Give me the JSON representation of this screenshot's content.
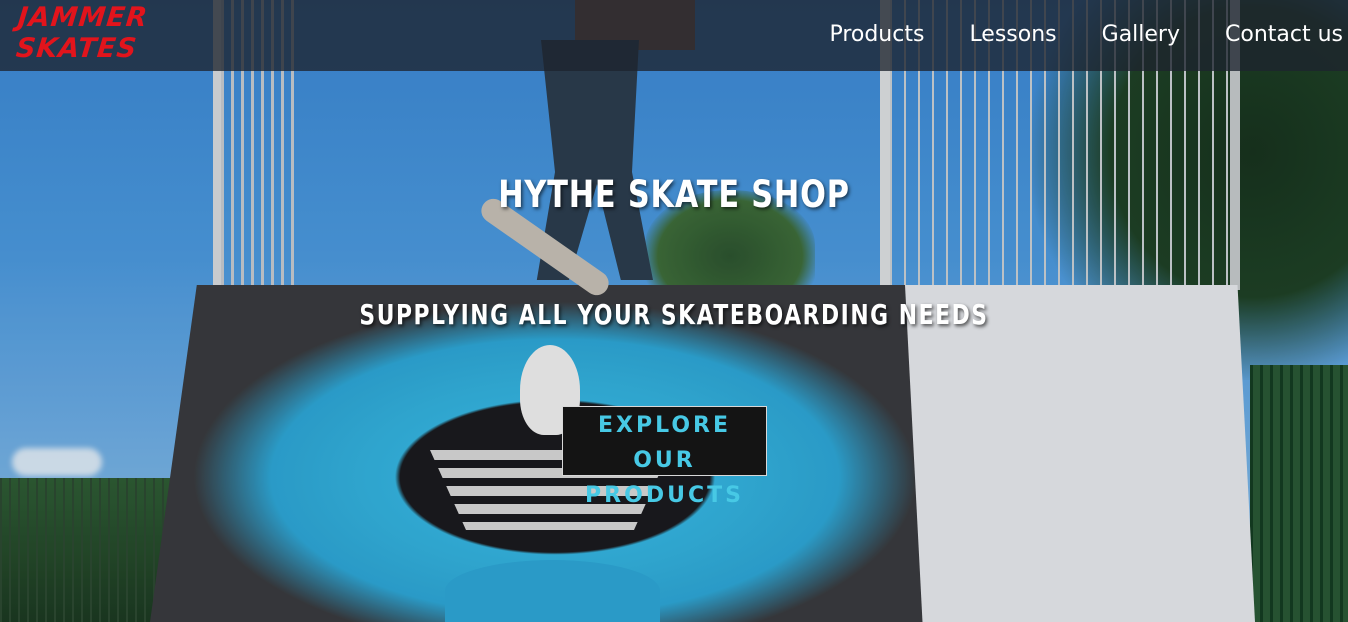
{
  "brand": {
    "logo_line1": "JAMMER",
    "logo_line2": "SKATES",
    "logo_color": "#e2141c"
  },
  "nav": {
    "items": [
      {
        "label": "Products"
      },
      {
        "label": "Lessons"
      },
      {
        "label": "Gallery"
      },
      {
        "label": "Contact us"
      }
    ]
  },
  "hero": {
    "title": "HYTHE SKATE SHOP",
    "subtitle": "SUPPLYING ALL YOUR SKATEBOARDING NEEDS",
    "cta_label": "EXPLORE OUR PRODUCTS",
    "cta_color": "#47c9e5",
    "background_image": "skateboarder-on-graffiti-halfpipe"
  }
}
